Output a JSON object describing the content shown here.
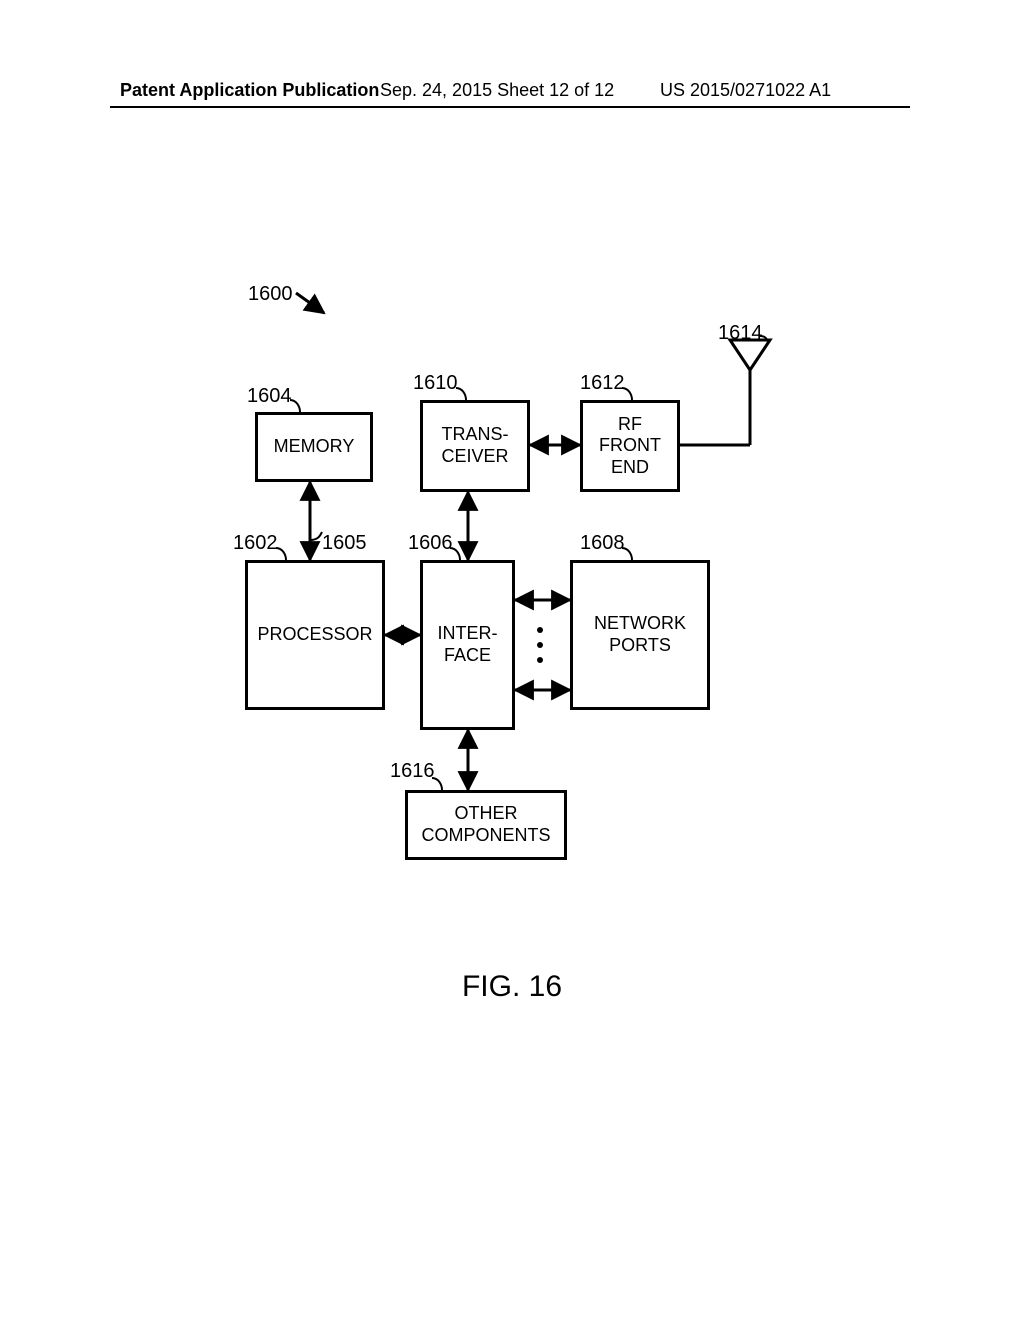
{
  "header": {
    "left": "Patent Application Publication",
    "center": "Sep. 24, 2015  Sheet 12 of 12",
    "right": "US 2015/0271022 A1"
  },
  "diagram": {
    "ref_overall": "1600",
    "memory": {
      "label": "MEMORY",
      "ref": "1604"
    },
    "transceiver": {
      "label_line1": "TRANS-",
      "label_line2": "CEIVER",
      "ref": "1610"
    },
    "rf_front_end": {
      "label_line1": "RF",
      "label_line2": "FRONT",
      "label_line3": "END",
      "ref": "1612"
    },
    "processor": {
      "label": "PROCESSOR",
      "ref": "1602"
    },
    "interface": {
      "label_line1": "INTER-",
      "label_line2": "FACE",
      "ref": "1606"
    },
    "network_ports": {
      "label_line1": "NETWORK",
      "label_line2": "PORTS",
      "ref": "1608"
    },
    "other_components": {
      "label_line1": "OTHER",
      "label_line2": "COMPONENTS",
      "ref": "1616"
    },
    "bus_ref": "1605",
    "antenna_ref": "1614"
  },
  "figure_caption": "FIG. 16"
}
